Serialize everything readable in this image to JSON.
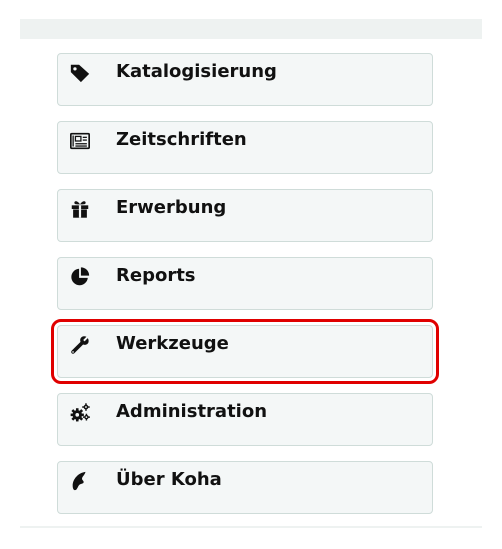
{
  "menu": {
    "items": [
      {
        "label": "Katalogisierung",
        "icon": "tag-icon"
      },
      {
        "label": "Zeitschriften",
        "icon": "newspaper-icon"
      },
      {
        "label": "Erwerbung",
        "icon": "gift-icon"
      },
      {
        "label": "Reports",
        "icon": "pie-chart-icon"
      },
      {
        "label": "Werkzeuge",
        "icon": "wrench-icon",
        "highlighted": true
      },
      {
        "label": "Administration",
        "icon": "gears-icon"
      },
      {
        "label": "Über Koha",
        "icon": "koha-logo-icon"
      }
    ]
  },
  "colors": {
    "highlight_border": "#e00000",
    "button_bg": "#f4f7f7",
    "button_border": "#cfdcd9",
    "icon": "#111111"
  }
}
